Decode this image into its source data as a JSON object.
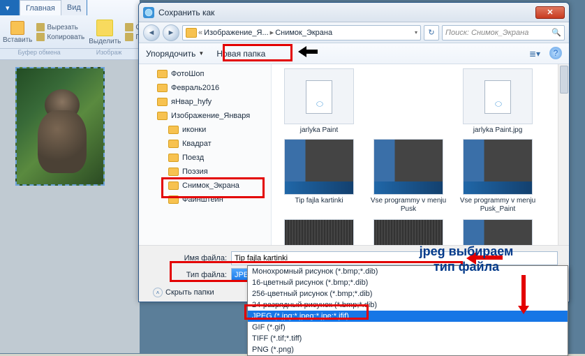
{
  "paint": {
    "tab_main": "Главная",
    "tab_view": "Вид",
    "paste": "Вставить",
    "cut": "Вырезать",
    "copy": "Копировать",
    "select": "Выделить",
    "crop": "Об",
    "rotate": "Пове",
    "group_clipboard": "Буфер обмена",
    "group_image": "Изображ"
  },
  "dialog": {
    "title": "Сохранить как",
    "nav_back": "◄",
    "nav_fwd": "►",
    "breadcrumb_1": "Изображение_Я...",
    "breadcrumb_2": "Снимок_Экрана",
    "search_placeholder": "Поиск: Снимок_Экрана",
    "toolbar_organize": "Упорядочить",
    "toolbar_newfolder": "Новая папка",
    "filename_label": "Имя файла:",
    "filename_value": "Tip fajla kartinki",
    "filetype_label": "Тип файла:",
    "filetype_value": "JPEG (*.jpg;*.jpeg;*.jpe;*.jfif)",
    "hide_folders": "Скрыть папки",
    "tree": [
      {
        "label": "ФотоШоп",
        "indent": 0
      },
      {
        "label": "Февраль2016",
        "indent": 0
      },
      {
        "label": "яНвар_hyfy",
        "indent": 0
      },
      {
        "label": "Изображение_Января",
        "indent": 0
      },
      {
        "label": "иконки",
        "indent": 1
      },
      {
        "label": "Квадрат",
        "indent": 1
      },
      {
        "label": "Поезд",
        "indent": 1
      },
      {
        "label": "Поэзия",
        "indent": 1
      },
      {
        "label": "Снимок_Экрана",
        "indent": 1
      },
      {
        "label": "Фаинштеин",
        "indent": 1
      }
    ],
    "grid": [
      {
        "label": "jarlyka Paint"
      },
      {
        "label": "jarlyka Paint.jpg"
      },
      {
        "label": "Tip fajla kartinki"
      },
      {
        "label": "Vse programmy v menju Pusk"
      },
      {
        "label": "Vse programmy v menju Pusk_Paint"
      }
    ],
    "dropdown": [
      "Монохромный рисунок (*.bmp;*.dib)",
      "16-цветный рисунок (*.bmp;*.dib)",
      "256-цветный рисунок (*.bmp;*.dib)",
      "24-разрядный рисунок (*.bmp;*.dib)",
      "JPEG (*.jpg;*.jpeg;*.jpe;*.jfif)",
      "GIF (*.gif)",
      "TIFF (*.tif;*.tiff)",
      "PNG (*.png)"
    ]
  },
  "annotation": {
    "line1": "jpeg выбираем",
    "line2": "тип файла"
  }
}
